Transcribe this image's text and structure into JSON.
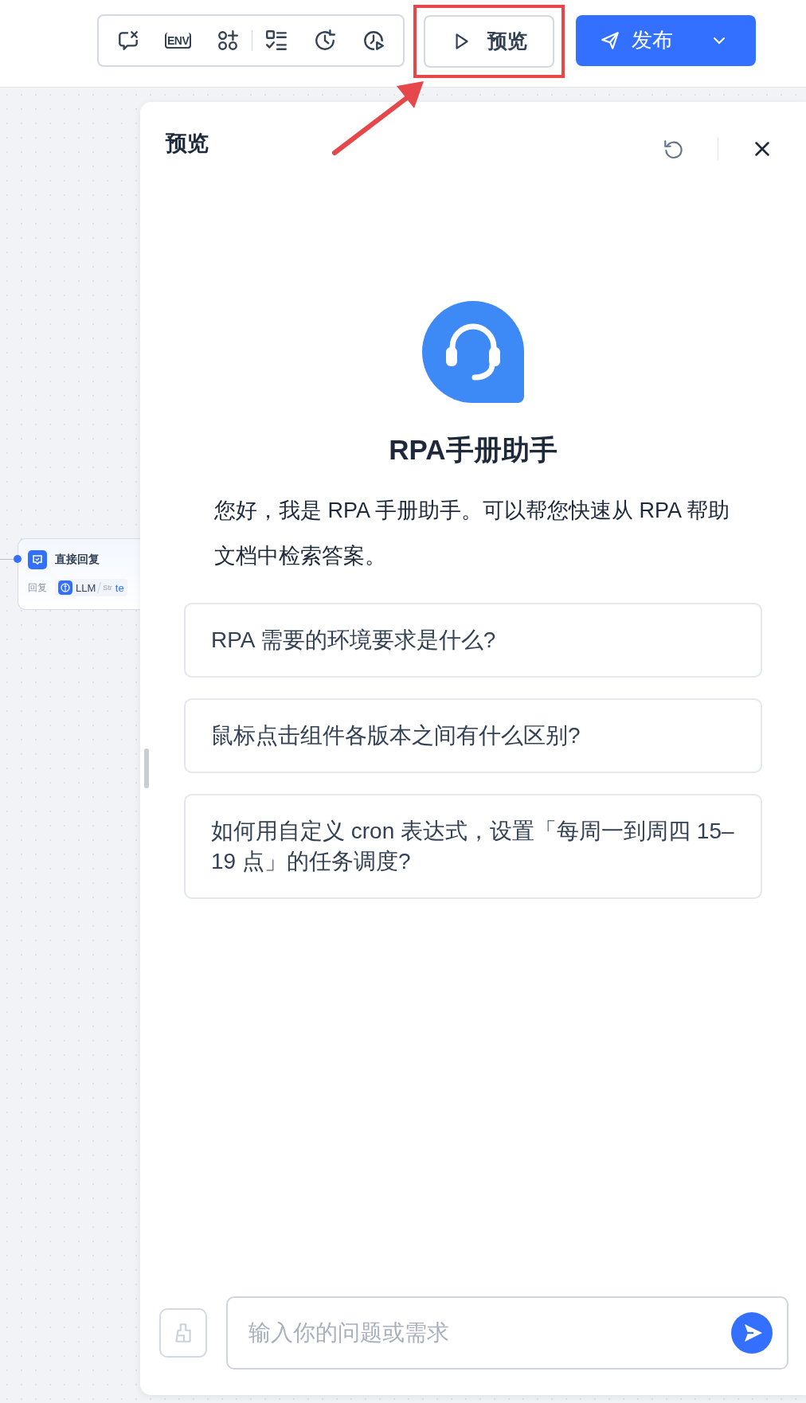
{
  "header": {
    "env_label": "ENV",
    "preview_button": "预览",
    "preview_highlighted": true,
    "publish_button": "发布"
  },
  "canvas": {
    "node": {
      "title": "直接回复",
      "field_label": "回复",
      "source": "LLM",
      "type_tag": "Str",
      "value": "te"
    }
  },
  "panel": {
    "title": "预览",
    "assistant_name": "RPA手册助手",
    "greeting": "您好，我是 RPA 手册助手。可以帮您快速从 RPA 帮助文档中检索答案。",
    "suggestions": [
      {
        "text": "RPA 需要的环境要求是什么?"
      },
      {
        "text": "鼠标点击组件各版本之间有什么区别?"
      },
      {
        "text": "如何用自定义 cron 表达式，设置「每周一到周四 15–19 点」的任务调度?"
      }
    ],
    "input": {
      "placeholder": "输入你的问题或需求"
    }
  }
}
